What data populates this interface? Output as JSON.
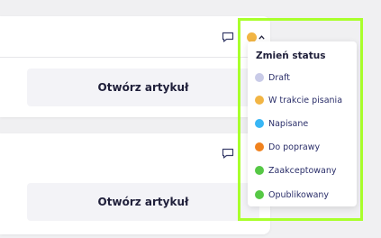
{
  "articles": [
    {
      "open_label": "Otwórz artykuł",
      "comment_icon": "comment-icon"
    },
    {
      "open_label": "Otwórz artykuł",
      "comment_icon": "comment-icon"
    }
  ],
  "status_trigger": {
    "color": "#f2b544",
    "icon": "chevron-up-icon"
  },
  "status_menu": {
    "title": "Zmień status",
    "options": [
      {
        "label": "Draft",
        "color": "#c9cbe8"
      },
      {
        "label": "W trakcie pisania",
        "color": "#f2b544"
      },
      {
        "label": "Napisane",
        "color": "#38b6f5"
      },
      {
        "label": "Do poprawy",
        "color": "#f0821e"
      },
      {
        "label": "Zaakceptowany",
        "color": "#56c845"
      },
      {
        "label": "Opublikowany",
        "color": "#56c845"
      }
    ]
  },
  "colors": {
    "highlight": "#a9ff2c",
    "text_primary": "#1f1f3a",
    "option_text": "#2b2f6a"
  }
}
